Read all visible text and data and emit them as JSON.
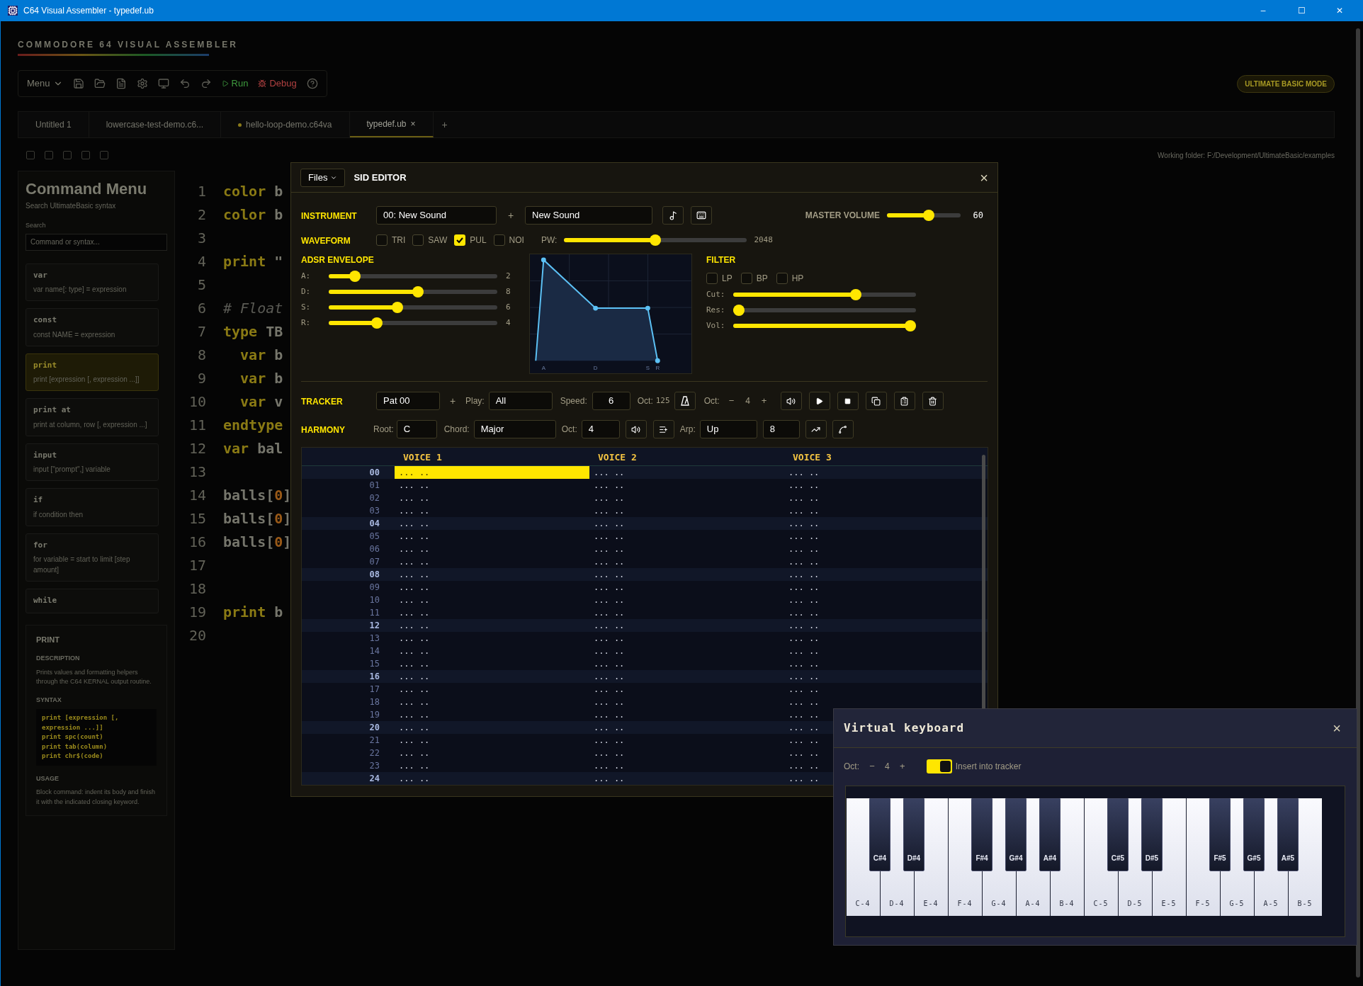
{
  "window": {
    "title": "C64 Visual Assembler - typedef.ub",
    "minimize": "–",
    "maximize": "☐",
    "close": "✕"
  },
  "app": {
    "brand": "COMMODORE 64 VISUAL ASSEMBLER",
    "menu": "Menu",
    "run": "Run",
    "debug": "Debug",
    "mode_badge": "ULTIMATE BASIC MODE",
    "working_folder": "Working folder: F:/Development/UltimateBasic/examples"
  },
  "tabs": [
    {
      "label": "Untitled 1",
      "selected": false,
      "modified": false
    },
    {
      "label": "lowercase-test-demo.c6...",
      "selected": false,
      "modified": false
    },
    {
      "label": "hello-loop-demo.c64va",
      "selected": false,
      "modified": true
    },
    {
      "label": "typedef.ub",
      "selected": true,
      "modified": false
    }
  ],
  "tab_close": "×",
  "new_tab": "+",
  "command_menu": {
    "title": "Command Menu",
    "subtitle": "Search UltimateBasic syntax",
    "search_label": "Search",
    "search_placeholder": "Command or syntax...",
    "items": [
      {
        "name": "var",
        "syntax": "var name[: type] = expression",
        "selected": false
      },
      {
        "name": "const",
        "syntax": "const NAME = expression",
        "selected": false
      },
      {
        "name": "print",
        "syntax": "print [expression [, expression ...]]",
        "selected": true
      },
      {
        "name": "print at",
        "syntax": "print at column, row [, expression ...]",
        "selected": false
      },
      {
        "name": "input",
        "syntax": "input [\"prompt\",] variable",
        "selected": false
      },
      {
        "name": "if",
        "syntax": "if condition then",
        "selected": false
      },
      {
        "name": "for",
        "syntax": "for variable = start to limit [step amount]",
        "selected": false
      },
      {
        "name": "while",
        "selected": false
      }
    ],
    "detail": {
      "title": "PRINT",
      "description_heading": "DESCRIPTION",
      "description": "Prints values and formatting helpers through the C64 KERNAL output routine.",
      "syntax_heading": "SYNTAX",
      "syntax_lines": [
        "print [expression [,",
        "expression ...]]",
        "print spc(count)",
        "print tab(column)",
        "print chr$(code)"
      ],
      "usage_heading": "USAGE",
      "usage": "Block command: indent its body and finish it with the indicated closing keyword."
    }
  },
  "code_lines": [
    {
      "number": "1",
      "tokens": [
        {
          "kind": "keyword",
          "text": "color"
        },
        {
          "kind": "plain",
          "text": " b"
        }
      ]
    },
    {
      "number": "2",
      "tokens": [
        {
          "kind": "keyword",
          "text": "color"
        },
        {
          "kind": "plain",
          "text": " b"
        }
      ]
    },
    {
      "number": "3"
    },
    {
      "number": "4",
      "tokens": [
        {
          "kind": "keyword",
          "text": "print"
        },
        {
          "kind": "plain",
          "text": " \""
        }
      ]
    },
    {
      "number": "5"
    },
    {
      "number": "6",
      "tokens": [
        {
          "kind": "comment",
          "text": "# Float"
        }
      ]
    },
    {
      "number": "7",
      "tokens": [
        {
          "kind": "keyword",
          "text": "type"
        },
        {
          "kind": "plain",
          "text": " TB"
        }
      ]
    },
    {
      "number": "8",
      "tokens": [
        {
          "kind": "keyword",
          "text": "  var"
        },
        {
          "kind": "plain",
          "text": " b"
        }
      ]
    },
    {
      "number": "9",
      "tokens": [
        {
          "kind": "keyword",
          "text": "  var"
        },
        {
          "kind": "plain",
          "text": " b"
        }
      ]
    },
    {
      "number": "10",
      "tokens": [
        {
          "kind": "keyword",
          "text": "  var"
        },
        {
          "kind": "plain",
          "text": " v"
        }
      ]
    },
    {
      "number": "11",
      "tokens": [
        {
          "kind": "keyword",
          "text": "endtype"
        }
      ]
    },
    {
      "number": "12",
      "tokens": [
        {
          "kind": "keyword",
          "text": "var"
        },
        {
          "kind": "plain",
          "text": " bal"
        }
      ]
    },
    {
      "number": "13"
    },
    {
      "number": "14",
      "tokens": [
        {
          "kind": "plain",
          "text": "balls["
        },
        {
          "kind": "number",
          "text": "0"
        },
        {
          "kind": "plain",
          "text": "]"
        }
      ]
    },
    {
      "number": "15",
      "tokens": [
        {
          "kind": "plain",
          "text": "balls["
        },
        {
          "kind": "number",
          "text": "0"
        },
        {
          "kind": "plain",
          "text": "]"
        }
      ]
    },
    {
      "number": "16",
      "tokens": [
        {
          "kind": "plain",
          "text": "balls["
        },
        {
          "kind": "number",
          "text": "0"
        },
        {
          "kind": "plain",
          "text": "]"
        }
      ]
    },
    {
      "number": "17"
    },
    {
      "number": "18"
    },
    {
      "number": "19",
      "tokens": [
        {
          "kind": "keyword",
          "text": "print"
        },
        {
          "kind": "plain",
          "text": " b"
        }
      ]
    },
    {
      "number": "20"
    }
  ],
  "sid_editor": {
    "files_button": "Files",
    "title": "SID EDITOR",
    "close": "×",
    "instrument": {
      "label": "INSTRUMENT",
      "select": "00: New Sound",
      "add": "+",
      "name": "New Sound"
    },
    "master_volume": {
      "label": "MASTER VOLUME",
      "level": 0.58,
      "reading": "60"
    },
    "waveform": {
      "label": "WAVEFORM",
      "options": [
        {
          "label": "TRI",
          "checked": false
        },
        {
          "label": "SAW",
          "checked": false
        },
        {
          "label": "PUL",
          "checked": true
        },
        {
          "label": "NOI",
          "checked": false
        }
      ],
      "pw": {
        "label": "PW:",
        "level": 0.5,
        "reading": "2048"
      }
    },
    "adsr": {
      "label": "ADSR ENVELOPE",
      "sliders": [
        {
          "label": "A:",
          "level": 0.13,
          "reading": "2"
        },
        {
          "label": "D:",
          "level": 0.53,
          "reading": "8"
        },
        {
          "label": "S:",
          "level": 0.4,
          "reading": "6"
        },
        {
          "label": "R:",
          "level": 0.27,
          "reading": "4"
        }
      ],
      "graph_labels": [
        "A",
        "D",
        "S",
        "R"
      ]
    },
    "filter": {
      "label": "FILTER",
      "modes": [
        {
          "label": "LP",
          "checked": false
        },
        {
          "label": "BP",
          "checked": false
        },
        {
          "label": "HP",
          "checked": false
        }
      ],
      "sliders": [
        {
          "label": "Cut:",
          "level": 0.68
        },
        {
          "label": "Res:",
          "level": 0.0
        },
        {
          "label": "Vol:",
          "level": 1.0
        }
      ]
    },
    "tracker": {
      "label": "TRACKER",
      "pattern": "Pat 00",
      "add": "+",
      "play_label": "Play:",
      "play": "All",
      "speed_label": "Speed:",
      "speed": "6",
      "tempo_label": "Oct:",
      "tempo": "125",
      "oct_label": "Oct:",
      "oct_minus": "−",
      "oct": "4",
      "oct_plus": "+"
    },
    "harmony": {
      "label": "HARMONY",
      "root_label": "Root:",
      "root": "C",
      "chord_label": "Chord:",
      "chord": "Major",
      "oct_label": "Oct:",
      "oct": "4",
      "arp_label": "Arp:",
      "arp": "Up",
      "arp_rate": "8"
    },
    "voices": [
      "VOICE 1",
      "VOICE 2",
      "VOICE 3"
    ],
    "rows": [
      {
        "number": "00",
        "beat": true,
        "cells": [
          {
            "text": "... ..",
            "selected": true
          },
          {
            "text": "... ..",
            "selected": false
          },
          {
            "text": "... ..",
            "selected": false
          }
        ]
      },
      {
        "number": "01",
        "beat": false,
        "cells": [
          {
            "text": "... ..",
            "selected": false
          },
          {
            "text": "... ..",
            "selected": false
          },
          {
            "text": "... ..",
            "selected": false
          }
        ]
      },
      {
        "number": "02",
        "beat": false,
        "cells": [
          {
            "text": "... ..",
            "selected": false
          },
          {
            "text": "... ..",
            "selected": false
          },
          {
            "text": "... ..",
            "selected": false
          }
        ]
      },
      {
        "number": "03",
        "beat": false,
        "cells": [
          {
            "text": "... ..",
            "selected": false
          },
          {
            "text": "... ..",
            "selected": false
          },
          {
            "text": "... ..",
            "selected": false
          }
        ]
      },
      {
        "number": "04",
        "beat": true,
        "cells": [
          {
            "text": "... ..",
            "selected": false
          },
          {
            "text": "... ..",
            "selected": false
          },
          {
            "text": "... ..",
            "selected": false
          }
        ]
      },
      {
        "number": "05",
        "beat": false,
        "cells": [
          {
            "text": "... ..",
            "selected": false
          },
          {
            "text": "... ..",
            "selected": false
          },
          {
            "text": "... ..",
            "selected": false
          }
        ]
      },
      {
        "number": "06",
        "beat": false,
        "cells": [
          {
            "text": "... ..",
            "selected": false
          },
          {
            "text": "... ..",
            "selected": false
          },
          {
            "text": "... ..",
            "selected": false
          }
        ]
      },
      {
        "number": "07",
        "beat": false,
        "cells": [
          {
            "text": "... ..",
            "selected": false
          },
          {
            "text": "... ..",
            "selected": false
          },
          {
            "text": "... ..",
            "selected": false
          }
        ]
      },
      {
        "number": "08",
        "beat": true,
        "cells": [
          {
            "text": "... ..",
            "selected": false
          },
          {
            "text": "... ..",
            "selected": false
          },
          {
            "text": "... ..",
            "selected": false
          }
        ]
      },
      {
        "number": "09",
        "beat": false,
        "cells": [
          {
            "text": "... ..",
            "selected": false
          },
          {
            "text": "... ..",
            "selected": false
          },
          {
            "text": "... ..",
            "selected": false
          }
        ]
      },
      {
        "number": "10",
        "beat": false,
        "cells": [
          {
            "text": "... ..",
            "selected": false
          },
          {
            "text": "... ..",
            "selected": false
          },
          {
            "text": "... ..",
            "selected": false
          }
        ]
      },
      {
        "number": "11",
        "beat": false,
        "cells": [
          {
            "text": "... ..",
            "selected": false
          },
          {
            "text": "... ..",
            "selected": false
          },
          {
            "text": "... ..",
            "selected": false
          }
        ]
      },
      {
        "number": "12",
        "beat": true,
        "cells": [
          {
            "text": "... ..",
            "selected": false
          },
          {
            "text": "... ..",
            "selected": false
          },
          {
            "text": "... ..",
            "selected": false
          }
        ]
      },
      {
        "number": "13",
        "beat": false,
        "cells": [
          {
            "text": "... ..",
            "selected": false
          },
          {
            "text": "... ..",
            "selected": false
          },
          {
            "text": "... ..",
            "selected": false
          }
        ]
      },
      {
        "number": "14",
        "beat": false,
        "cells": [
          {
            "text": "... ..",
            "selected": false
          },
          {
            "text": "... ..",
            "selected": false
          },
          {
            "text": "... ..",
            "selected": false
          }
        ]
      },
      {
        "number": "15",
        "beat": false,
        "cells": [
          {
            "text": "... ..",
            "selected": false
          },
          {
            "text": "... ..",
            "selected": false
          },
          {
            "text": "... ..",
            "selected": false
          }
        ]
      },
      {
        "number": "16",
        "beat": true,
        "cells": [
          {
            "text": "... ..",
            "selected": false
          },
          {
            "text": "... ..",
            "selected": false
          },
          {
            "text": "... ..",
            "selected": false
          }
        ]
      },
      {
        "number": "17",
        "beat": false,
        "cells": [
          {
            "text": "... ..",
            "selected": false
          },
          {
            "text": "... ..",
            "selected": false
          },
          {
            "text": "... ..",
            "selected": false
          }
        ]
      },
      {
        "number": "18",
        "beat": false,
        "cells": [
          {
            "text": "... ..",
            "selected": false
          },
          {
            "text": "... ..",
            "selected": false
          },
          {
            "text": "... ..",
            "selected": false
          }
        ]
      },
      {
        "number": "19",
        "beat": false,
        "cells": [
          {
            "text": "... ..",
            "selected": false
          },
          {
            "text": "... ..",
            "selected": false
          },
          {
            "text": "... ..",
            "selected": false
          }
        ]
      },
      {
        "number": "20",
        "beat": true,
        "cells": [
          {
            "text": "... ..",
            "selected": false
          },
          {
            "text": "... ..",
            "selected": false
          },
          {
            "text": "... ..",
            "selected": false
          }
        ]
      },
      {
        "number": "21",
        "beat": false,
        "cells": [
          {
            "text": "... ..",
            "selected": false
          },
          {
            "text": "... ..",
            "selected": false
          },
          {
            "text": "... ..",
            "selected": false
          }
        ]
      },
      {
        "number": "22",
        "beat": false,
        "cells": [
          {
            "text": "... ..",
            "selected": false
          },
          {
            "text": "... ..",
            "selected": false
          },
          {
            "text": "... ..",
            "selected": false
          }
        ]
      },
      {
        "number": "23",
        "beat": false,
        "cells": [
          {
            "text": "... ..",
            "selected": false
          },
          {
            "text": "... ..",
            "selected": false
          },
          {
            "text": "... ..",
            "selected": false
          }
        ]
      },
      {
        "number": "24",
        "beat": true,
        "cells": [
          {
            "text": "... ..",
            "selected": false
          },
          {
            "text": "... ..",
            "selected": false
          },
          {
            "text": "... ..",
            "selected": false
          }
        ]
      }
    ]
  },
  "keyboard": {
    "title": "Virtual keyboard",
    "close": "×",
    "oct_label": "Oct:",
    "oct_minus": "−",
    "oct": "4",
    "oct_plus": "+",
    "insert": {
      "label": "Insert into tracker",
      "on": true
    },
    "keys": [
      {
        "label": "C-4",
        "sharp": "C#4"
      },
      {
        "label": "D-4",
        "sharp": "D#4"
      },
      {
        "label": "E-4"
      },
      {
        "label": "F-4",
        "sharp": "F#4"
      },
      {
        "label": "G-4",
        "sharp": "G#4"
      },
      {
        "label": "A-4",
        "sharp": "A#4"
      },
      {
        "label": "B-4"
      },
      {
        "label": "C-5",
        "sharp": "C#5"
      },
      {
        "label": "D-5",
        "sharp": "D#5"
      },
      {
        "label": "E-5"
      },
      {
        "label": "F-5",
        "sharp": "F#5"
      },
      {
        "label": "G-5",
        "sharp": "G#5"
      },
      {
        "label": "A-5",
        "sharp": "A#5"
      },
      {
        "label": "B-5"
      }
    ]
  }
}
